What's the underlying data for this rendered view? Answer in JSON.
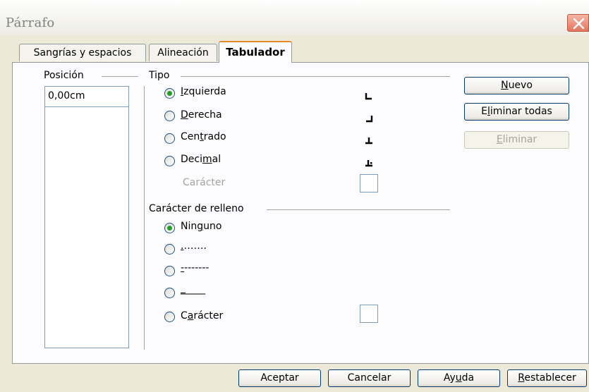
{
  "window": {
    "title": "Párrafo"
  },
  "tabs": [
    {
      "label": "Sangrías y espacios"
    },
    {
      "label": "Alineación"
    },
    {
      "label": "Tabulador"
    }
  ],
  "position": {
    "legend": "Posición",
    "value": "0,00cm"
  },
  "type": {
    "legend": "Tipo",
    "options": [
      {
        "prefix": "",
        "mnemonic": "I",
        "suffix": "zquierda",
        "checked": true,
        "icon": "tab-left-icon"
      },
      {
        "prefix": "",
        "mnemonic": "D",
        "suffix": "erecha",
        "checked": false,
        "icon": "tab-right-icon"
      },
      {
        "prefix": "Cen",
        "mnemonic": "t",
        "suffix": "rado",
        "checked": false,
        "icon": "tab-center-icon"
      },
      {
        "prefix": "Deci",
        "mnemonic": "m",
        "suffix": "al",
        "checked": false,
        "icon": "tab-decimal-icon"
      }
    ],
    "character_label": "Carácter"
  },
  "fill": {
    "legend": "Carácter de relleno",
    "options": [
      {
        "prefix": "Nin",
        "mnemonic": "g",
        "suffix": "uno",
        "checked": true
      },
      {
        "prefix": "",
        "mnemonic": ".",
        "suffix": "…….",
        "checked": false
      },
      {
        "prefix": "",
        "mnemonic": "-",
        "suffix": "-------",
        "checked": false
      },
      {
        "prefix": "",
        "mnemonic": "_",
        "suffix": "____",
        "checked": false
      },
      {
        "prefix": "C",
        "mnemonic": "a",
        "suffix": "rácter",
        "checked": false
      }
    ]
  },
  "actions": {
    "new_prefix": "",
    "new_mnemonic": "N",
    "new_suffix": "uevo",
    "delete_all_prefix": "E",
    "delete_all_mnemonic": "l",
    "delete_all_suffix": "iminar todas",
    "delete_prefix": "",
    "delete_mnemonic": "E",
    "delete_suffix": "liminar"
  },
  "footer": {
    "ok": "Aceptar",
    "cancel": "Cancelar",
    "help_prefix": "Ay",
    "help_mnemonic": "u",
    "help_suffix": "da",
    "reset_prefix": "",
    "reset_mnemonic": "R",
    "reset_suffix": "establecer"
  }
}
